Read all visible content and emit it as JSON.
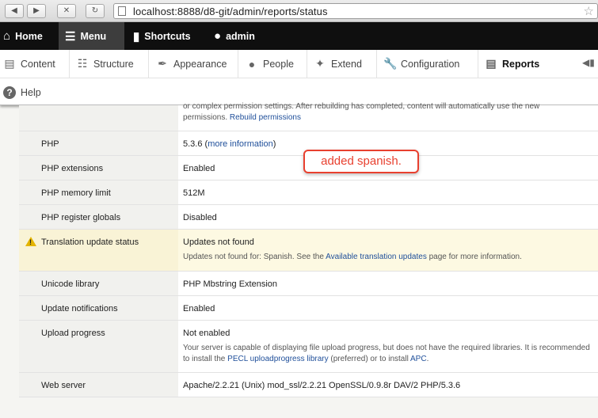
{
  "browser": {
    "url": "localhost:8888/d8-git/admin/reports/status"
  },
  "toolbar": {
    "items": [
      {
        "label": "Home"
      },
      {
        "label": "Menu"
      },
      {
        "label": "Shortcuts"
      },
      {
        "label": "admin"
      }
    ]
  },
  "tray": {
    "items": [
      {
        "label": "Content"
      },
      {
        "label": "Structure"
      },
      {
        "label": "Appearance"
      },
      {
        "label": "People"
      },
      {
        "label": "Extend"
      },
      {
        "label": "Configuration"
      },
      {
        "label": "Reports"
      },
      {
        "label": "Help"
      }
    ]
  },
  "rows": {
    "partial": {
      "line1": "or complex permission settings. After rebuilding has completed, content will automatically use the new",
      "line2": "permissions.",
      "link": "Rebuild permissions"
    },
    "php": {
      "label": "PHP",
      "value": "5.3.6 (",
      "link": "more information",
      "suffix": ")"
    },
    "php_ext": {
      "label": "PHP extensions",
      "value": "Enabled"
    },
    "php_mem": {
      "label": "PHP memory limit",
      "value": "512M"
    },
    "php_reg": {
      "label": "PHP register globals",
      "value": "Disabled"
    },
    "translation": {
      "label": "Translation update status",
      "value": "Updates not found",
      "desc_pre": "Updates not found for: Spanish. See the ",
      "desc_link": "Available translation updates",
      "desc_post": " page for more information."
    },
    "unicode": {
      "label": "Unicode library",
      "value": "PHP Mbstring Extension"
    },
    "update_notif": {
      "label": "Update notifications",
      "value": "Enabled"
    },
    "upload": {
      "label": "Upload progress",
      "value": "Not enabled",
      "desc_pre": "Your server is capable of displaying file upload progress, but does not have the required libraries. It is recommended to install the ",
      "desc_link1": "PECL uploadprogress library",
      "desc_mid": " (preferred) or to install ",
      "desc_link2": "APC",
      "desc_post": "."
    },
    "webserver": {
      "label": "Web server",
      "value": "Apache/2.2.21 (Unix) mod_ssl/2.2.21 OpenSSL/0.9.8r DAV/2 PHP/5.3.6"
    }
  },
  "annotation": {
    "text": "added spanish."
  }
}
